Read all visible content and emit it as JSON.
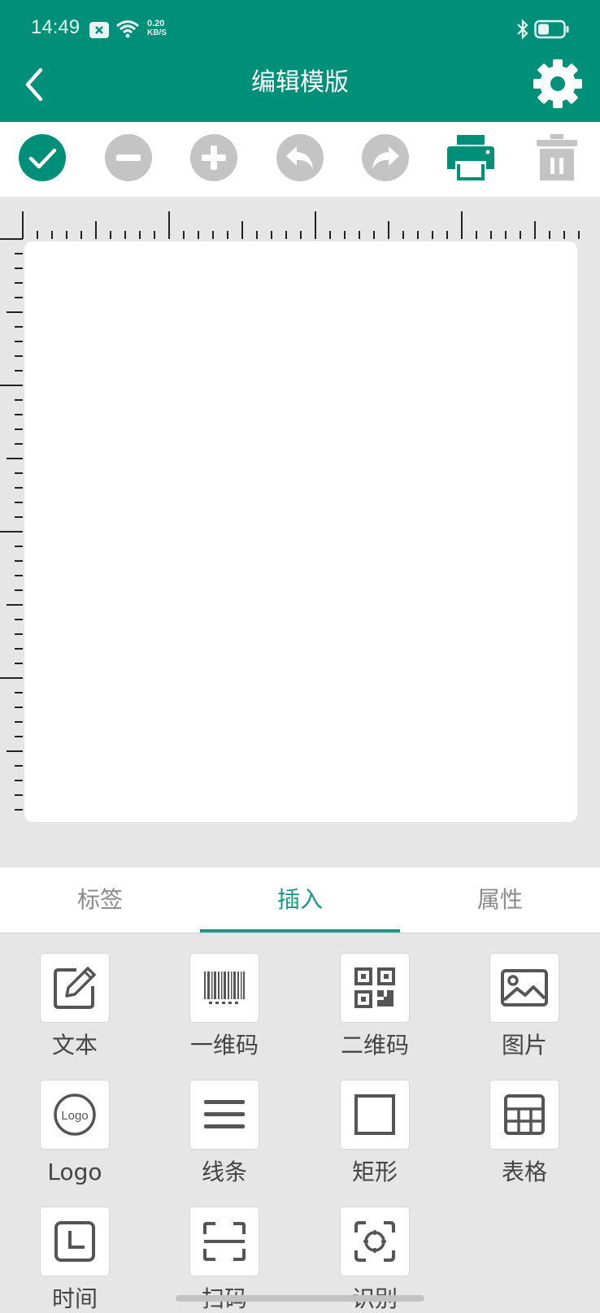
{
  "status_bar": {
    "time": "14:49",
    "net_speed_value": "0.20",
    "net_speed_unit": "KB/S",
    "icons": [
      "notification-icon",
      "wifi-icon",
      "bluetooth-icon",
      "battery-icon"
    ]
  },
  "header": {
    "title": "编辑模版",
    "back_icon": "chevron-left-icon",
    "settings_icon": "gear-icon",
    "background": "#00907a"
  },
  "toolbar": {
    "buttons": [
      {
        "name": "confirm",
        "icon": "check-circle-icon",
        "color": "#00907a"
      },
      {
        "name": "zoom-out",
        "icon": "minus-circle-icon",
        "color": "#c4c4c4"
      },
      {
        "name": "zoom-in",
        "icon": "plus-circle-icon",
        "color": "#c4c4c4"
      },
      {
        "name": "undo",
        "icon": "undo-icon",
        "color": "#c4c4c4"
      },
      {
        "name": "redo",
        "icon": "redo-icon",
        "color": "#c4c4c4"
      },
      {
        "name": "print",
        "icon": "printer-icon",
        "color": "#00907a"
      },
      {
        "name": "delete",
        "icon": "trash-icon",
        "color": "#c4c4c4"
      }
    ]
  },
  "tabs": {
    "items": [
      {
        "label": "标签"
      },
      {
        "label": "插入"
      },
      {
        "label": "属性"
      }
    ],
    "active": "插入",
    "accent": "#1a9a86"
  },
  "insert_tools": {
    "items": [
      {
        "label": "文本",
        "icon": "edit-text-icon"
      },
      {
        "label": "一维码",
        "icon": "barcode-icon"
      },
      {
        "label": "二维码",
        "icon": "qr-code-icon"
      },
      {
        "label": "图片",
        "icon": "image-icon"
      },
      {
        "label": "Logo",
        "icon": "logo-icon"
      },
      {
        "label": "线条",
        "icon": "lines-icon"
      },
      {
        "label": "矩形",
        "icon": "rectangle-icon"
      },
      {
        "label": "表格",
        "icon": "table-icon"
      },
      {
        "label": "时间",
        "icon": "clock-icon"
      },
      {
        "label": "扫码",
        "icon": "scan-icon"
      },
      {
        "label": "识别",
        "icon": "recognize-icon"
      }
    ]
  }
}
